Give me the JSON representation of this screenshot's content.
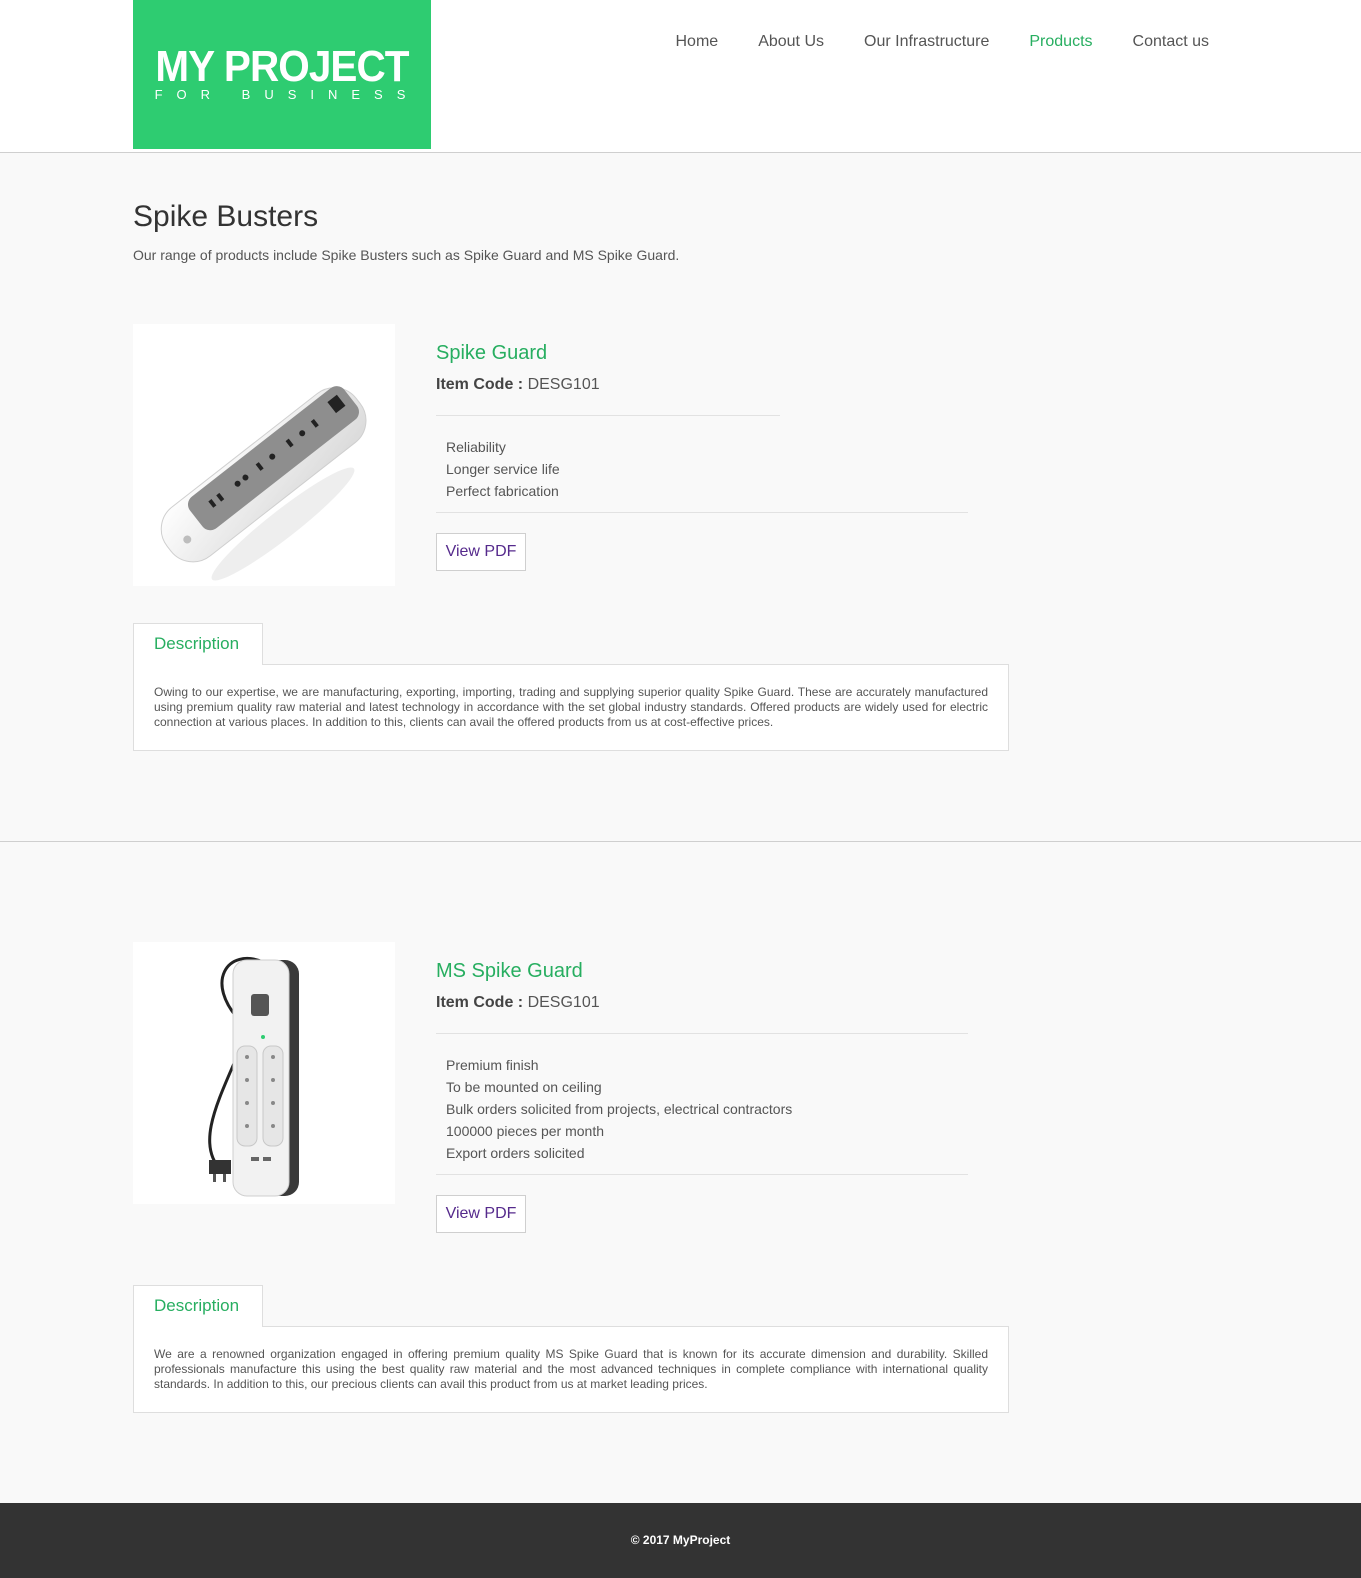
{
  "brand": {
    "name": "MY PROJECT",
    "tagline": "FOR BUSINESS",
    "color": "#2ecc71"
  },
  "nav": {
    "items": [
      {
        "label": "Home"
      },
      {
        "label": "About Us"
      },
      {
        "label": "Our Infrastructure"
      },
      {
        "label": "Products",
        "active": true
      },
      {
        "label": "Contact us"
      }
    ]
  },
  "page": {
    "title": "Spike Busters",
    "intro": "Our range of products include Spike Busters such as Spike Guard and MS Spike Guard."
  },
  "products": [
    {
      "name": "Spike Guard",
      "item_code_label": "Item Code :",
      "item_code": "DESG101",
      "features": [
        "Reliability",
        "Longer service life",
        "Perfect fabrication"
      ],
      "pdf_label": "View PDF",
      "desc_tab": "Description",
      "description": "Owing to our expertise, we are manufacturing, exporting, importing, trading and supplying superior quality Spike Guard. These are accurately manufactured using premium quality raw material and latest technology in accordance with the set global industry standards. Offered products are widely used for electric connection at various places. In addition to this, clients can avail the offered products from us at cost-effective prices."
    },
    {
      "name": "MS Spike Guard",
      "item_code_label": "Item Code :",
      "item_code": "DESG101",
      "features": [
        "Premium finish",
        "To be mounted on ceiling",
        "Bulk orders solicited from projects, electrical contractors",
        "100000 pieces per month",
        "Export orders solicited"
      ],
      "pdf_label": "View PDF",
      "desc_tab": "Description",
      "description": "We are a renowned organization engaged in offering premium quality MS Spike Guard that is known for its accurate dimension and durability. Skilled professionals manufacture this using the best quality raw material and the most advanced techniques in complete compliance with international quality standards. In addition to this, our precious clients can avail this product from us at market leading prices."
    }
  ],
  "footer": {
    "text": "© 2017 MyProject"
  },
  "colors": {
    "accent": "#27ae60",
    "link": "#552a8c",
    "footer_bg": "#333333"
  }
}
